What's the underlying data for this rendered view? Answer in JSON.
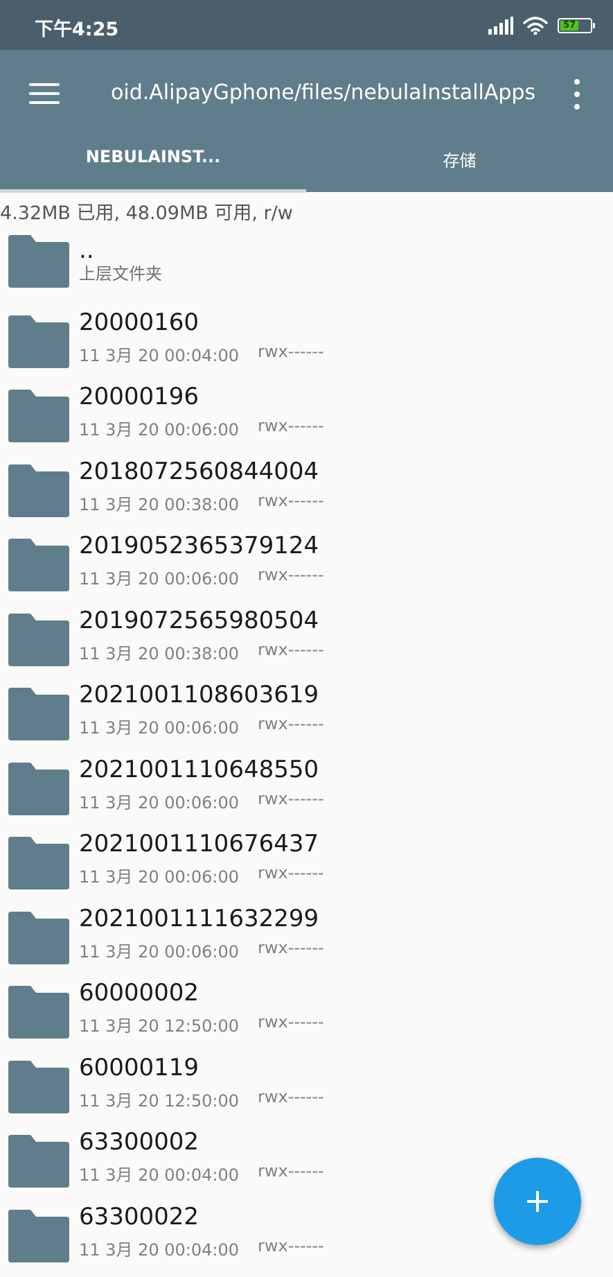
{
  "status_bar": {
    "time": "下午4:25",
    "battery": "57",
    "icons": [
      "signal-icon",
      "wifi-icon",
      "battery-icon"
    ]
  },
  "toolbar": {
    "path": "oid.AlipayGphone/files/nebulaInstallApps",
    "menu_icon": "menu-icon",
    "more_icon": "more-vert-icon"
  },
  "tabs": [
    {
      "label": "NEBULAINST...",
      "selected": true
    },
    {
      "label": "存储",
      "selected": false
    }
  ],
  "storage_info": "4.32MB 已用, 48.09MB 可用, r/w",
  "parent": {
    "name": "..",
    "subtitle": "上层文件夹"
  },
  "files": [
    {
      "name": "20000160",
      "date": "11 3月 20 00:04:00",
      "perm": "rwx------"
    },
    {
      "name": "20000196",
      "date": "11 3月 20 00:06:00",
      "perm": "rwx------"
    },
    {
      "name": "2018072560844004",
      "date": "11 3月 20 00:38:00",
      "perm": "rwx------"
    },
    {
      "name": "2019052365379124",
      "date": "11 3月 20 00:06:00",
      "perm": "rwx------"
    },
    {
      "name": "2019072565980504",
      "date": "11 3月 20 00:38:00",
      "perm": "rwx------"
    },
    {
      "name": "2021001108603619",
      "date": "11 3月 20 00:06:00",
      "perm": "rwx------"
    },
    {
      "name": "2021001110648550",
      "date": "11 3月 20 00:06:00",
      "perm": "rwx------"
    },
    {
      "name": "2021001110676437",
      "date": "11 3月 20 00:06:00",
      "perm": "rwx------"
    },
    {
      "name": "2021001111632299",
      "date": "11 3月 20 00:06:00",
      "perm": "rwx------"
    },
    {
      "name": "60000002",
      "date": "11 3月 20 12:50:00",
      "perm": "rwx------"
    },
    {
      "name": "60000119",
      "date": "11 3月 20 12:50:00",
      "perm": "rwx------"
    },
    {
      "name": "63300002",
      "date": "11 3月 20 00:04:00",
      "perm": "rwx------"
    },
    {
      "name": "63300022",
      "date": "11 3月 20 00:04:00",
      "perm": "rwx------"
    }
  ],
  "fab": {
    "icon": "plus-icon"
  },
  "colors": {
    "status_bar": "#4a5f6b",
    "toolbar": "#607d8b",
    "folder": "#607d8b",
    "fab": "#1e9be6",
    "battery_fill": "#52c41a"
  }
}
